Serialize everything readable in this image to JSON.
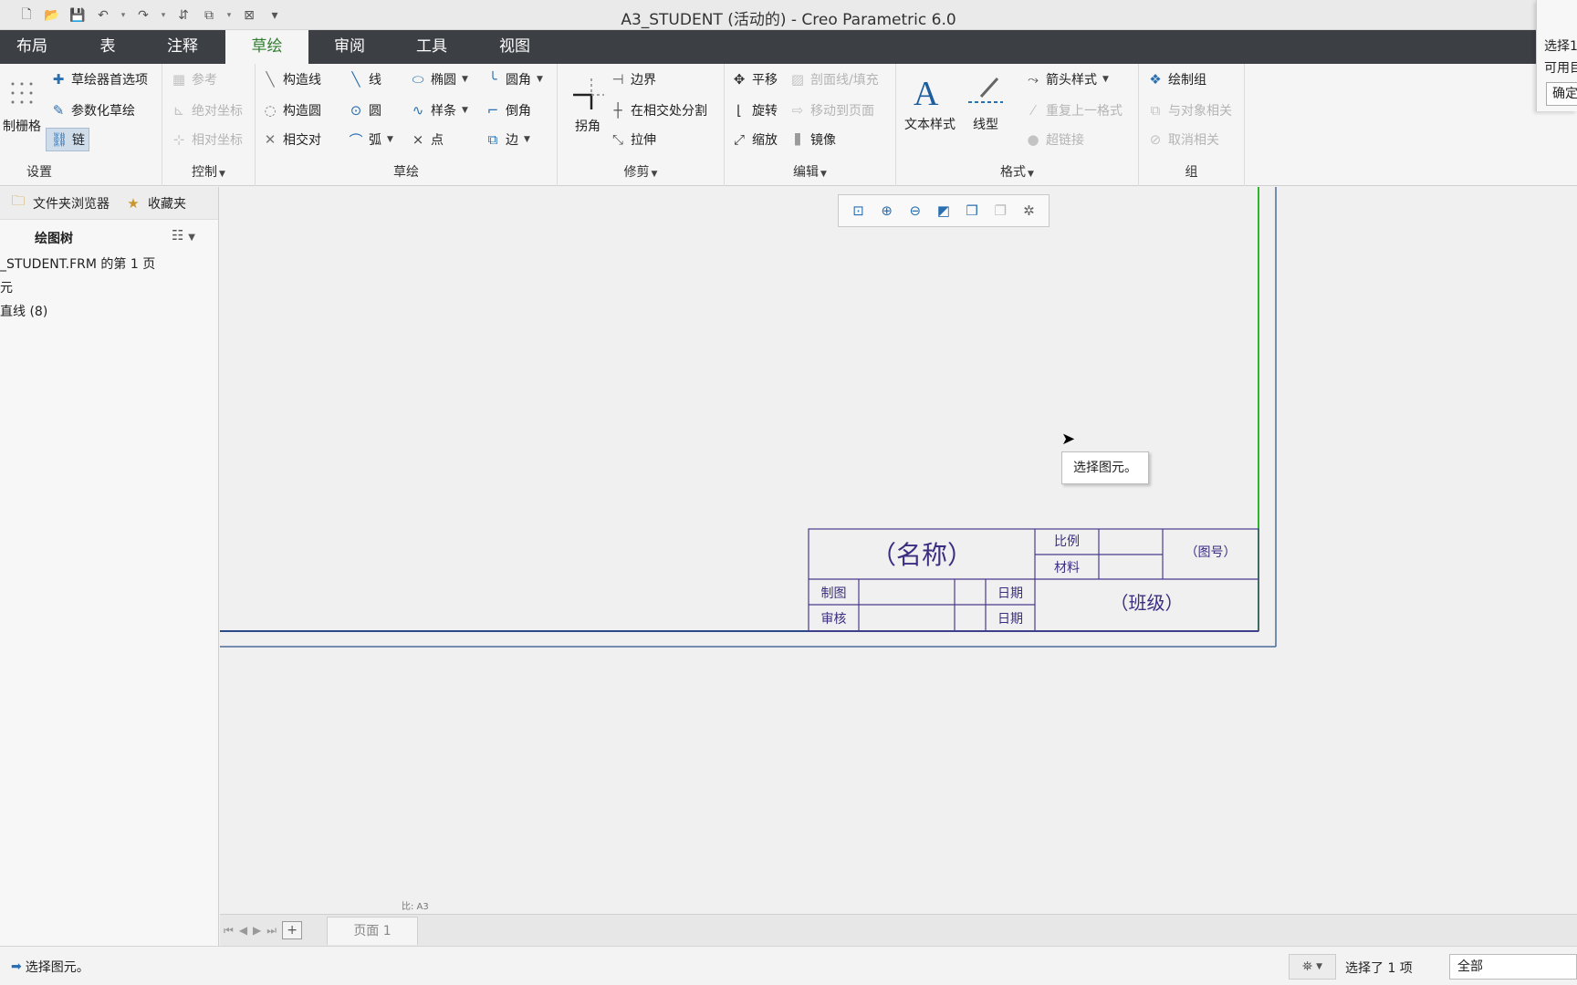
{
  "window": {
    "title": "A3_STUDENT (活动的) - Creo Parametric 6.0"
  },
  "tabs": [
    "布局",
    "表",
    "注释",
    "草绘",
    "审阅",
    "工具",
    "视图"
  ],
  "active_tab": "草绘",
  "ribbon": {
    "setup": {
      "label": "设置",
      "grid": "制栅格",
      "sketcher_prefs": "草绘器首选项",
      "param_sketch": "参数化草绘",
      "chain": "链"
    },
    "control": {
      "label": "控制",
      "reference": "参考",
      "abs_coord": "绝对坐标",
      "rel_coord": "相对坐标"
    },
    "sketch": {
      "label": "草绘",
      "construction_line": "构造线",
      "construction_circle": "构造圆",
      "intersect": "相交对",
      "line": "线",
      "circle": "圆",
      "arc": "弧",
      "ellipse": "椭圆",
      "spline": "样条",
      "point": "点",
      "fillet": "圆角",
      "chamfer": "倒角",
      "edge": "边"
    },
    "trim": {
      "label": "修剪",
      "corner": "拐角",
      "boundary": "边界",
      "divide_at_intersect": "在相交处分割",
      "stretch": "拉伸"
    },
    "edit": {
      "label": "编辑",
      "translate": "平移",
      "rotate": "旋转",
      "scale": "缩放",
      "hatch": "剖面线/填充",
      "move_to_page": "移动到页面",
      "mirror": "镜像"
    },
    "format": {
      "label": "格式",
      "text_style": "文本样式",
      "line_style": "线型",
      "arrow_style": "箭头样式",
      "repeat_format": "重复上一格式",
      "hyperlink": "超链接"
    },
    "group": {
      "label": "组",
      "draw_group": "绘制组",
      "relate_to_object": "与对象相关",
      "unrelate": "取消相关"
    }
  },
  "dialog_fragment": {
    "line1": "选择1",
    "line2": "可用目",
    "ok": "确定"
  },
  "left_panel": {
    "folder_browser": "文件夹浏览器",
    "favorites": "收藏夹",
    "tree_title": "绘图树",
    "tree_items": [
      "_STUDENT.FRM 的第 1 页",
      "元",
      "直线 (8)"
    ]
  },
  "title_block": {
    "name": "（名称）",
    "scale": "比例",
    "material": "材料",
    "drawing_no": "（图号）",
    "drawn_by": "制图",
    "checked_by": "审核",
    "date1": "日期",
    "date2": "日期",
    "class": "（班级）"
  },
  "tooltip": "选择图元。",
  "scale_note": "比: A3",
  "page_tab": "页面 1",
  "status": {
    "message": "选择图元。",
    "selected": "选择了 1 项",
    "filter": "全部"
  },
  "colors": {
    "tab_bar": "#3c3f44",
    "active_tab_text": "#2f7d2f",
    "border_green": "#2db42d",
    "title_block": "#4b3a8c",
    "icon_blue": "#2a6fb0"
  }
}
